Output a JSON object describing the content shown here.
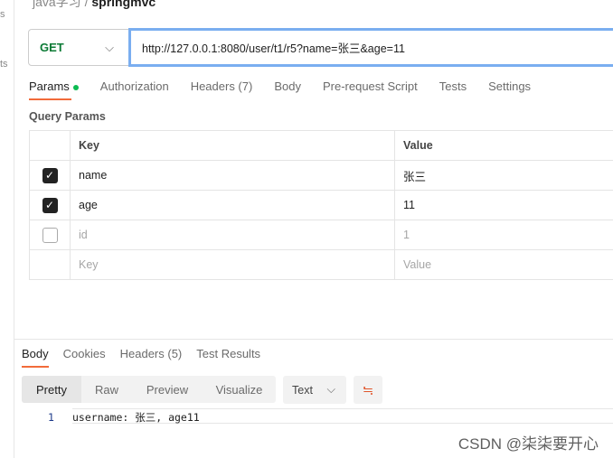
{
  "sidebar": {
    "frag1": "s",
    "frag2": "ts"
  },
  "breadcrumb": {
    "workspace": "java学习",
    "separator": "/",
    "collection": "springmvc"
  },
  "request": {
    "method": "GET",
    "url": "http://127.0.0.1:8080/user/t1/r5?name=张三&age=11"
  },
  "request_tabs": [
    "Params",
    "Authorization",
    "Headers (7)",
    "Body",
    "Pre-request Script",
    "Tests",
    "Settings"
  ],
  "query_params": {
    "title": "Query Params",
    "headers": {
      "key": "Key",
      "value": "Value"
    },
    "rows": [
      {
        "checked": true,
        "key": "name",
        "value": "张三"
      },
      {
        "checked": true,
        "key": "age",
        "value": "11"
      },
      {
        "checked": false,
        "key": "id",
        "value": "1"
      }
    ],
    "placeholder": {
      "key": "Key",
      "value": "Value"
    }
  },
  "response_tabs": [
    "Body",
    "Cookies",
    "Headers (5)",
    "Test Results"
  ],
  "view_modes": [
    "Pretty",
    "Raw",
    "Preview",
    "Visualize"
  ],
  "format": "Text",
  "response": {
    "line": "1",
    "text": "username: 张三, age11"
  },
  "watermark": "CSDN @柒柒要开心",
  "colors": {
    "accent": "#f26b3a",
    "method": "#0b7a35",
    "url_focus": "#7aaef0",
    "params_dot": "#0cbb52"
  }
}
